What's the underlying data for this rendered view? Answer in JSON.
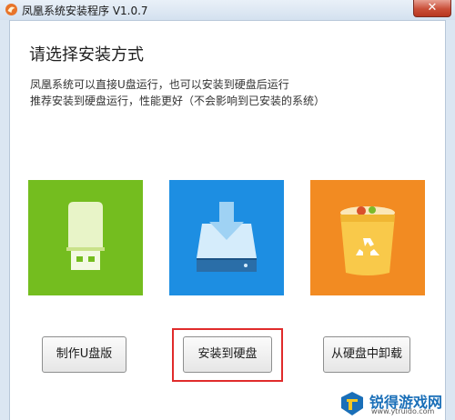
{
  "window": {
    "title": "凤凰系统安装程序 V1.0.7",
    "close_glyph": "✕",
    "app_icon": "phoenix-logo-icon"
  },
  "heading": "请选择安装方式",
  "description": [
    "凤凰系统可以直接U盘运行，也可以安装到硬盘后运行",
    "推荐安装到硬盘运行，性能更好（不会影响到已安装的系统）"
  ],
  "options": [
    {
      "icon": "usb-drive-icon",
      "color": "#74bd1f",
      "button": "制作U盘版"
    },
    {
      "icon": "hard-disk-download-icon",
      "color": "#1d8ee2",
      "button": "安装到硬盘",
      "highlighted": true
    },
    {
      "icon": "recycle-bin-icon",
      "color": "#f28b22",
      "button": "从硬盘中卸载"
    }
  ],
  "watermark": {
    "brand": "锐得游戏网",
    "url": "www.ytruido.com"
  },
  "colors": {
    "highlight_border": "#e02b2b",
    "usb_tile": "#74bd1f",
    "disk_tile": "#1d8ee2",
    "uninstall_tile": "#f28b22"
  }
}
